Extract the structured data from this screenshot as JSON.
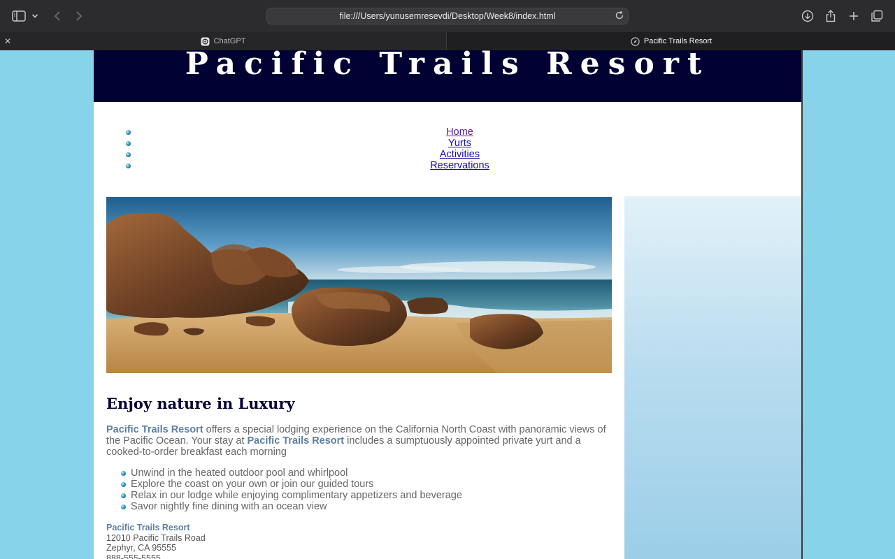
{
  "browser": {
    "url": "file:///Users/yunusemresevdi/Desktop/Week8/index.html",
    "icons": {
      "sidebar": "sidebar-toggle-icon",
      "chevron": "chevron-down-icon",
      "back": "back-arrow-icon",
      "forward": "forward-arrow-icon",
      "reload": "reload-icon",
      "downloads": "download-icon",
      "share": "share-icon",
      "new_tab": "plus-icon",
      "tab_overview": "tab-overview-icon"
    },
    "tabs": [
      {
        "label": "ChatGPT"
      },
      {
        "label": "Pacific Trails Resort",
        "active": true
      }
    ]
  },
  "site": {
    "title": "Pacific Trails Resort",
    "nav": [
      {
        "label": "Home"
      },
      {
        "label": "Yurts"
      },
      {
        "label": "Activities"
      },
      {
        "label": "Reservations"
      }
    ],
    "main": {
      "heading": "Enjoy nature in Luxury",
      "paragraph": {
        "brand": "Pacific Trails Resort",
        "part1": " offers a special lodging experience on the California North Coast with panoramic views of the Pacific Ocean. Your stay at ",
        "part2": " includes a sumptuously appointed private yurt and a cooked-to-order breakfast each morning"
      },
      "features": [
        "Unwind in the heated outdoor pool and whirlpool",
        "Explore the coast on your own or join our guided tours",
        "Relax in our lodge while enjoying complimentary appetizers and beverage",
        "Savor nightly fine dining with an ocean view"
      ],
      "address": {
        "name": "Pacific Trails Resort",
        "street": "12010 Pacific Trails Road",
        "city": "Zephyr, CA 95555",
        "phone": "888-555-5555"
      }
    },
    "colors": {
      "background": "#87d3ea",
      "header": "#000033",
      "brand_text": "#5c7fa3",
      "body_text": "#666666"
    }
  }
}
